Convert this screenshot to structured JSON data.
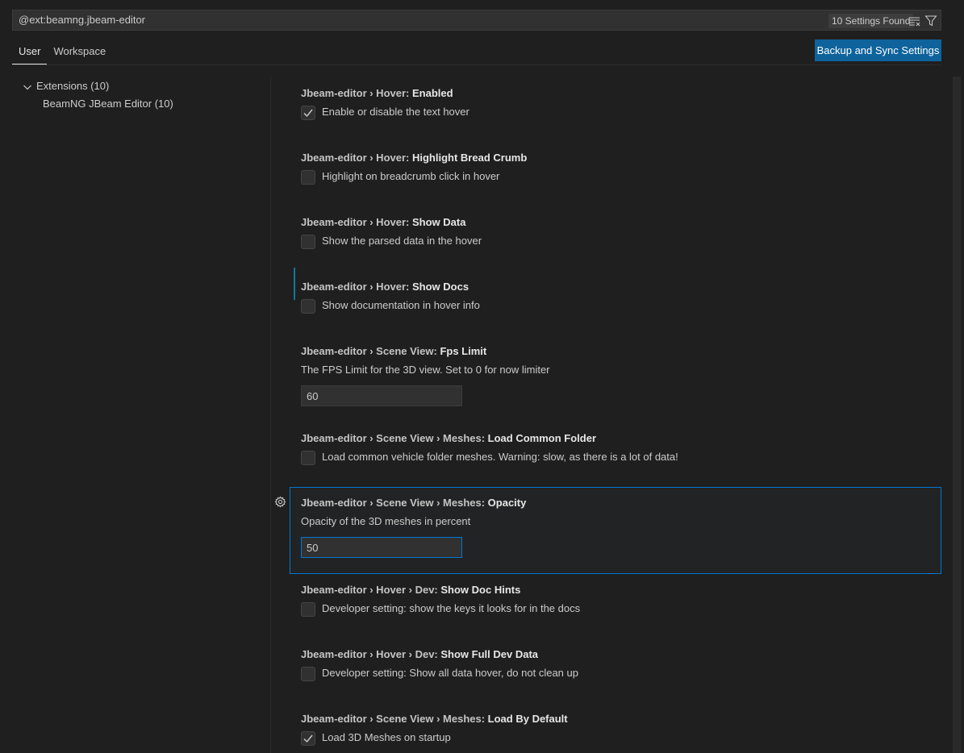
{
  "search": {
    "value": "@ext:beamng.jbeam-editor",
    "count": "10 Settings Found",
    "clear_icon": "clear-filter-icon",
    "filter_icon": "filter-icon"
  },
  "tabs": [
    {
      "label": "User",
      "active": true
    },
    {
      "label": "Workspace",
      "active": false
    }
  ],
  "sync_button": "Backup and Sync Settings",
  "toc": {
    "group_label": "Extensions (10)",
    "child_label": "BeamNG JBeam Editor (10)"
  },
  "settings": [
    {
      "category": "Jbeam-editor › Hover: ",
      "name": "Enabled",
      "description": "Enable or disable the text hover",
      "type": "checkbox",
      "checked": true,
      "modified": false
    },
    {
      "category": "Jbeam-editor › Hover: ",
      "name": "Highlight Bread Crumb",
      "description": "Highlight on breadcrumb click in hover",
      "type": "checkbox",
      "checked": false,
      "modified": false
    },
    {
      "category": "Jbeam-editor › Hover: ",
      "name": "Show Data",
      "description": "Show the parsed data in the hover",
      "type": "checkbox",
      "checked": false,
      "modified": true
    },
    {
      "category": "Jbeam-editor › Hover: ",
      "name": "Show Docs",
      "description": "Show documentation in hover info",
      "type": "checkbox",
      "checked": false,
      "modified": true
    },
    {
      "category": "Jbeam-editor › Scene View: ",
      "name": "Fps Limit",
      "description": "The FPS Limit for the 3D view. Set to 0 for now limiter",
      "type": "number",
      "value": "60"
    },
    {
      "category": "Jbeam-editor › Scene View › Meshes: ",
      "name": "Load Common Folder",
      "description": "Load common vehicle folder meshes. Warning: slow, as there is a lot of data!",
      "type": "checkbox",
      "checked": false,
      "modified": false
    },
    {
      "category": "Jbeam-editor › Scene View › Meshes: ",
      "name": "Opacity",
      "description": "Opacity of the 3D meshes in percent",
      "type": "number",
      "value": "50",
      "focused": true
    },
    {
      "category": "Jbeam-editor › Hover › Dev: ",
      "name": "Show Doc Hints",
      "description": "Developer setting: show the keys it looks for in the docs",
      "type": "checkbox",
      "checked": false,
      "modified": false
    },
    {
      "category": "Jbeam-editor › Hover › Dev: ",
      "name": "Show Full Dev Data",
      "description": "Developer setting: Show all data hover, do not clean up",
      "type": "checkbox",
      "checked": false,
      "modified": false
    },
    {
      "category": "Jbeam-editor › Scene View › Meshes: ",
      "name": "Load By Default",
      "description": "Load 3D Meshes on startup",
      "type": "checkbox",
      "checked": true,
      "modified": false
    }
  ],
  "colors": {
    "background": "#1f1f1f",
    "accent": "#0078d4",
    "button": "#0e639c",
    "modified_indicator": "#0b7a94"
  }
}
